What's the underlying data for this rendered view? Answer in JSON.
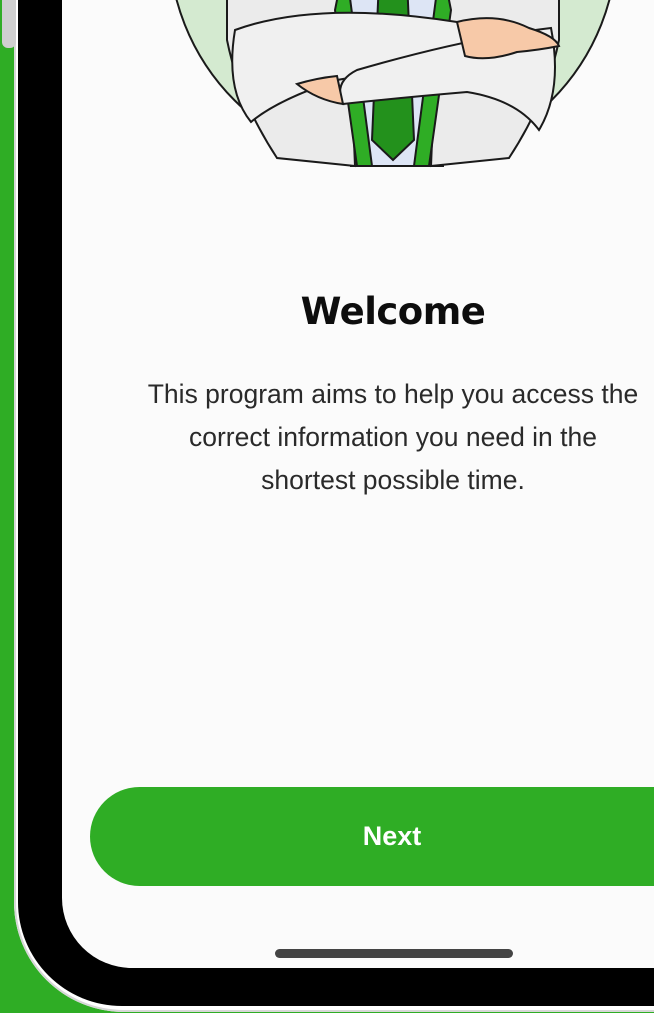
{
  "onboarding": {
    "title": "Welcome",
    "description_lines": [
      "This program aims to help you access the",
      "correct information you need in the",
      "shortest possible time."
    ],
    "next_label": "Next"
  },
  "illustration": {
    "icon": "businessman-arms-crossed-illustration"
  },
  "colors": {
    "brand_green": "#2fad25",
    "screen_background": "#fbfbfb",
    "illustration_circle": "#d4ead0",
    "title_text": "#0d0d0d",
    "body_text": "#2a2a2a",
    "home_indicator": "#444444"
  }
}
